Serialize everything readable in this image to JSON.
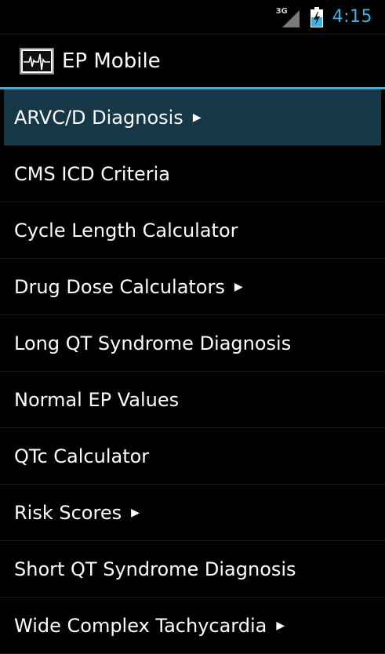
{
  "status_bar": {
    "network_label": "3G",
    "time": "4:15",
    "icons": [
      "signal-icon",
      "battery-charging-icon"
    ]
  },
  "action_bar": {
    "icon": "ecg-logo-icon",
    "title": "EP Mobile"
  },
  "menu": {
    "items": [
      {
        "label": "ARVC/D Diagnosis",
        "has_submenu": true,
        "selected": true
      },
      {
        "label": "CMS ICD Criteria",
        "has_submenu": false
      },
      {
        "label": "Cycle Length Calculator",
        "has_submenu": false
      },
      {
        "label": "Drug Dose Calculators",
        "has_submenu": true
      },
      {
        "label": "Long QT Syndrome Diagnosis",
        "has_submenu": false
      },
      {
        "label": "Normal EP Values",
        "has_submenu": false
      },
      {
        "label": "QTc Calculator",
        "has_submenu": false
      },
      {
        "label": "Risk Scores",
        "has_submenu": true
      },
      {
        "label": "Short QT Syndrome Diagnosis",
        "has_submenu": false
      },
      {
        "label": "Wide Complex Tachycardia",
        "has_submenu": true
      }
    ],
    "submenu_glyph": "▶"
  },
  "colors": {
    "accent": "#33b5e5",
    "selected_bg": "#163747",
    "background": "#000000"
  }
}
